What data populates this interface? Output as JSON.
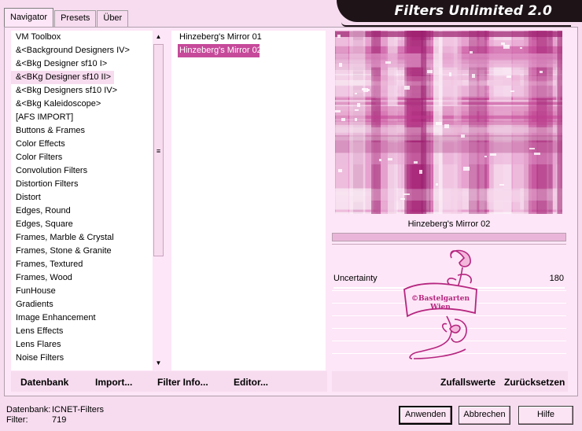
{
  "app": {
    "title": "Filters Unlimited 2.0"
  },
  "tabs": [
    {
      "label": "Navigator",
      "active": true
    },
    {
      "label": "Presets",
      "active": false
    },
    {
      "label": "Über",
      "active": false
    }
  ],
  "categories": [
    {
      "label": "VM Toolbox"
    },
    {
      "label": "&<Background Designers IV>"
    },
    {
      "label": "&<Bkg Designer sf10 I>"
    },
    {
      "label": "&<BKg Designer sf10 II>",
      "selected": true
    },
    {
      "label": "&<Bkg Designers sf10 IV>"
    },
    {
      "label": "&<Bkg Kaleidoscope>"
    },
    {
      "label": "[AFS IMPORT]"
    },
    {
      "label": "Buttons & Frames"
    },
    {
      "label": "Color Effects"
    },
    {
      "label": "Color Filters"
    },
    {
      "label": "Convolution Filters"
    },
    {
      "label": "Distortion Filters"
    },
    {
      "label": "Distort"
    },
    {
      "label": "Edges, Round"
    },
    {
      "label": "Edges, Square"
    },
    {
      "label": "Frames, Marble & Crystal"
    },
    {
      "label": "Frames, Stone & Granite"
    },
    {
      "label": "Frames, Textured"
    },
    {
      "label": "Frames, Wood"
    },
    {
      "label": "FunHouse"
    },
    {
      "label": "Gradients"
    },
    {
      "label": "Image Enhancement"
    },
    {
      "label": "Lens Effects"
    },
    {
      "label": "Lens Flares"
    },
    {
      "label": "Noise Filters"
    }
  ],
  "filters": [
    {
      "label": "Hinzeberg's Mirror 01",
      "selected": false
    },
    {
      "label": "Hinzeberg's Mirror 02",
      "selected": true
    }
  ],
  "preview": {
    "caption": "Hinzeberg's Mirror 02",
    "colors": [
      "#c03a8e",
      "#e7a2d0",
      "#f6d6ec",
      "#ffffff",
      "#9b1f6e"
    ]
  },
  "parameters": [
    {
      "name": "Uncertainty",
      "value": "180"
    }
  ],
  "watermark": {
    "line1": "©Bastelgarten",
    "line2": "Wien"
  },
  "left_buttons": [
    {
      "label": "Datenbank"
    },
    {
      "label": "Import..."
    },
    {
      "label": "Filter Info..."
    },
    {
      "label": "Editor..."
    }
  ],
  "right_buttons": [
    {
      "label": "Zufallswerte"
    },
    {
      "label": "Zurücksetzen"
    }
  ],
  "status": {
    "db_label": "Datenbank:",
    "db_value": "ICNET-Filters",
    "filter_label": "Filter:",
    "filter_value": "719"
  },
  "dialog_buttons": {
    "apply": "Anwenden",
    "cancel": "Abbrechen",
    "help": "Hilfe"
  },
  "scrollbar": {
    "up": "▲",
    "grip": "≡",
    "down": "▼"
  },
  "colors": {
    "background": "#f7dcef",
    "panel": "#fde6f7",
    "selection": "#c64a9a",
    "banner": "#1e1418"
  }
}
